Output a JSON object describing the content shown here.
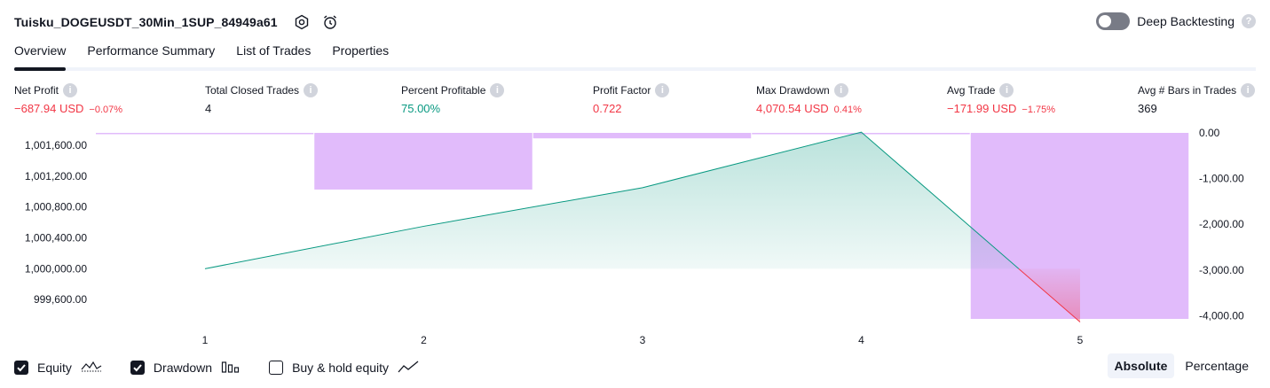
{
  "header": {
    "strategy_name": "Tuisku_DOGEUSDT_30Min_1SUP_84949a61",
    "icons": [
      "settings-icon",
      "alert-clock-icon"
    ],
    "deep_backtesting_label": "Deep Backtesting",
    "deep_backtesting_enabled": false,
    "help": "?"
  },
  "tabs": [
    {
      "label": "Overview",
      "active": true
    },
    {
      "label": "Performance Summary",
      "active": false
    },
    {
      "label": "List of Trades",
      "active": false
    },
    {
      "label": "Properties",
      "active": false
    }
  ],
  "metrics": [
    {
      "label": "Net Profit",
      "value": "−687.94 USD",
      "sub": "−0.07%",
      "tone": "neg"
    },
    {
      "label": "Total Closed Trades",
      "value": "4",
      "sub": "",
      "tone": "neutral"
    },
    {
      "label": "Percent Profitable",
      "value": "75.00%",
      "sub": "",
      "tone": "pos"
    },
    {
      "label": "Profit Factor",
      "value": "0.722",
      "sub": "",
      "tone": "neg"
    },
    {
      "label": "Max Drawdown",
      "value": "4,070.54 USD",
      "sub": "0.41%",
      "tone": "neg"
    },
    {
      "label": "Avg Trade",
      "value": "−171.99 USD",
      "sub": "−1.75%",
      "tone": "neg"
    },
    {
      "label": "Avg # Bars in Trades",
      "value": "369",
      "sub": "",
      "tone": "neutral"
    }
  ],
  "chart_data": {
    "type": "line",
    "x": [
      1,
      2,
      3,
      4,
      5
    ],
    "x_tick_labels": [
      "1",
      "2",
      "3",
      "4",
      "5"
    ],
    "left_axis": {
      "ticks": [
        999600,
        1000000,
        1000400,
        1000800,
        1001200,
        1001600
      ],
      "tick_labels": [
        "999,600.00",
        "1,000,000.00",
        "1,000,400.00",
        "1,000,800.00",
        "1,001,200.00",
        "1,001,600.00"
      ],
      "range": [
        999350,
        1001760
      ]
    },
    "right_axis": {
      "ticks": [
        0,
        -1000,
        -2000,
        -3000,
        -4000
      ],
      "tick_labels": [
        "0.00",
        "-1,000.00",
        "-2,000.00",
        "-3,000.00",
        "-4,000.00"
      ],
      "range": [
        -4070,
        0
      ]
    },
    "equity": {
      "values": [
        1000000,
        1000550,
        1001050,
        1001770,
        999310
      ],
      "baseline": 1000000,
      "color_up": "#089981",
      "color_down": "#f23645"
    },
    "drawdown": {
      "trade_values": [
        0,
        -1240,
        -120,
        -30,
        -4070
      ],
      "color": "#e1bbfb"
    }
  },
  "legend": {
    "items": [
      {
        "label": "Equity",
        "checked": true,
        "icon": "equity-icon"
      },
      {
        "label": "Drawdown",
        "checked": true,
        "icon": "drawdown-bars-icon"
      },
      {
        "label": "Buy & hold equity",
        "checked": false,
        "icon": "buy-hold-line-icon"
      }
    ],
    "modes": [
      {
        "label": "Absolute",
        "active": true
      },
      {
        "label": "Percentage",
        "active": false
      }
    ]
  }
}
